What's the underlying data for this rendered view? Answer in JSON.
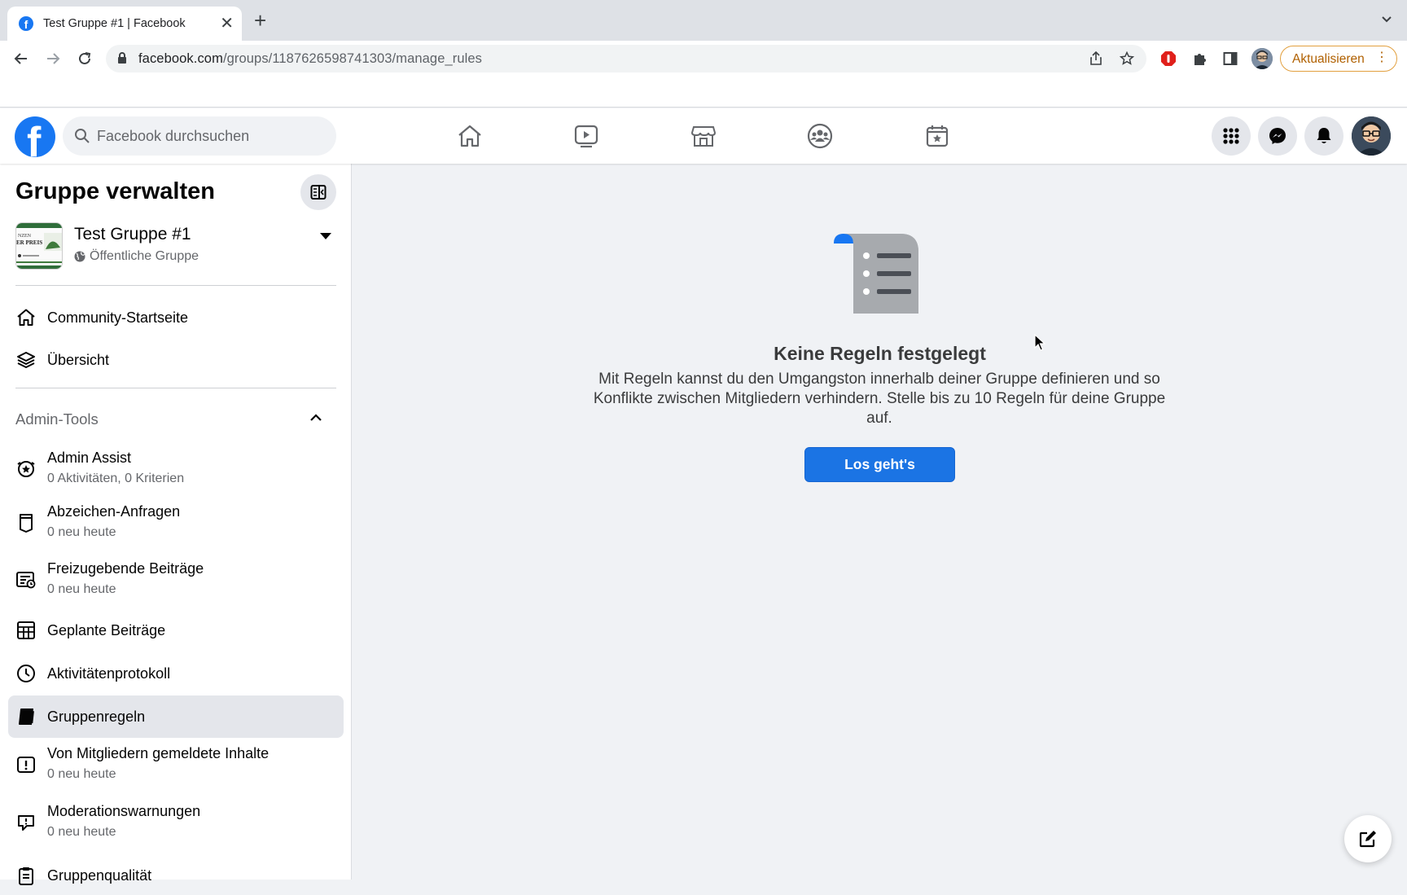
{
  "browser": {
    "tab_title": "Test Gruppe #1 | Facebook",
    "tab_close": "✕",
    "new_tab": "+",
    "url_domain": "facebook.com",
    "url_path": "/groups/1187626598741303/manage_rules",
    "update_label": "Aktualisieren",
    "menu_glyph": "⋮"
  },
  "facebook": {
    "logo_letter": "f",
    "search_placeholder": "Facebook durchsuchen",
    "nav": [
      "home-icon",
      "video-icon",
      "marketplace-icon",
      "groups-icon",
      "gaming-icon"
    ],
    "brand_color": "#1877f2"
  },
  "sidebar": {
    "title": "Gruppe verwalten",
    "group_name": "Test Gruppe #1",
    "group_privacy": "Öffentliche Gruppe",
    "items_top": [
      {
        "label": "Community-Startseite"
      },
      {
        "label": "Übersicht"
      }
    ],
    "section_title": "Admin-Tools",
    "admin_tools": [
      {
        "label": "Admin Assist",
        "sub": "0 Aktivitäten, 0 Kriterien"
      },
      {
        "label": "Abzeichen-Anfragen",
        "sub": "0 neu heute"
      },
      {
        "label": "Freizugebende Beiträge",
        "sub": "0 neu heute"
      },
      {
        "label": "Geplante Beiträge"
      },
      {
        "label": "Aktivitätenprotokoll"
      },
      {
        "label": "Gruppenregeln",
        "active": true
      },
      {
        "label": "Von Mitgliedern gemeldete Inhalte",
        "sub": "0 neu heute"
      },
      {
        "label": "Moderationswarnungen",
        "sub": "0 neu heute"
      },
      {
        "label": "Gruppenqualität"
      }
    ]
  },
  "main": {
    "empty_title": "Keine Regeln festgelegt",
    "empty_desc": "Mit Regeln kannst du den Umgangston innerhalb deiner Gruppe definieren und so Konflikte zwischen Mitgliedern verhindern. Stelle bis zu 10 Regeln für deine Gruppe auf.",
    "cta_label": "Los geht's"
  }
}
